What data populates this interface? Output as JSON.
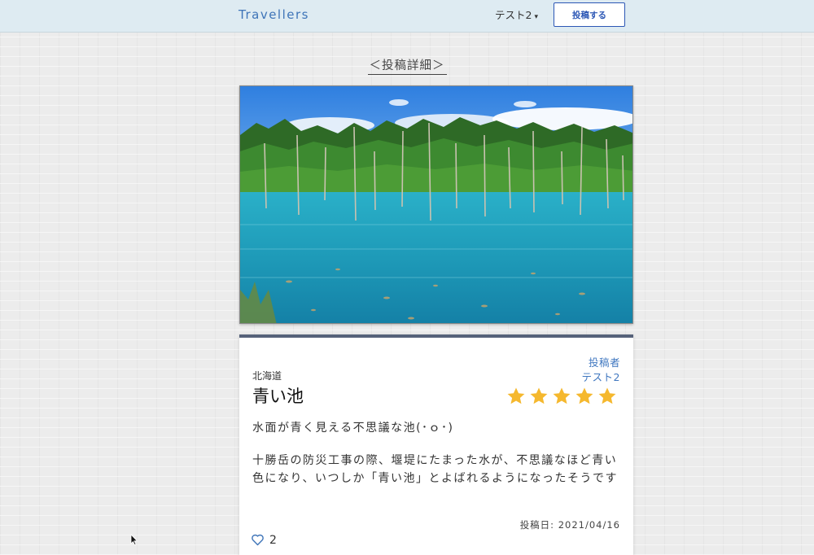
{
  "navbar": {
    "brand": "Travellers",
    "user_menu_label": "テスト2",
    "user_menu_caret": "▾",
    "post_button_label": "投稿する"
  },
  "page": {
    "heading": "＜投稿詳細＞"
  },
  "post": {
    "photo_subject": "blue pond with dead trees and forest",
    "poster_label": "投稿者",
    "poster_name": "テスト2",
    "prefecture": "北海道",
    "title": "青い池",
    "rating": 5,
    "rating_max": 5,
    "summary": "水面が青く見える不思議な池(･ｏ･)",
    "body": "十勝岳の防災工事の際、堰堤にたまった水が、不思議なほど青い色になり、いつしか「青い池」とよばれるようになったそうです",
    "posted_date_label": "投稿日: 2021/04/16",
    "like_count": "2"
  },
  "icons": {
    "star": "star-icon",
    "heart": "heart-outline-icon",
    "caret": "caret-down-icon",
    "cursor": "mouse-pointer-icon"
  },
  "colors": {
    "navbar_bg": "#deebf2",
    "brand": "#3e74b8",
    "primary": "#2c57b5",
    "star": "#f5b82e",
    "card_accent": "#56627a"
  }
}
